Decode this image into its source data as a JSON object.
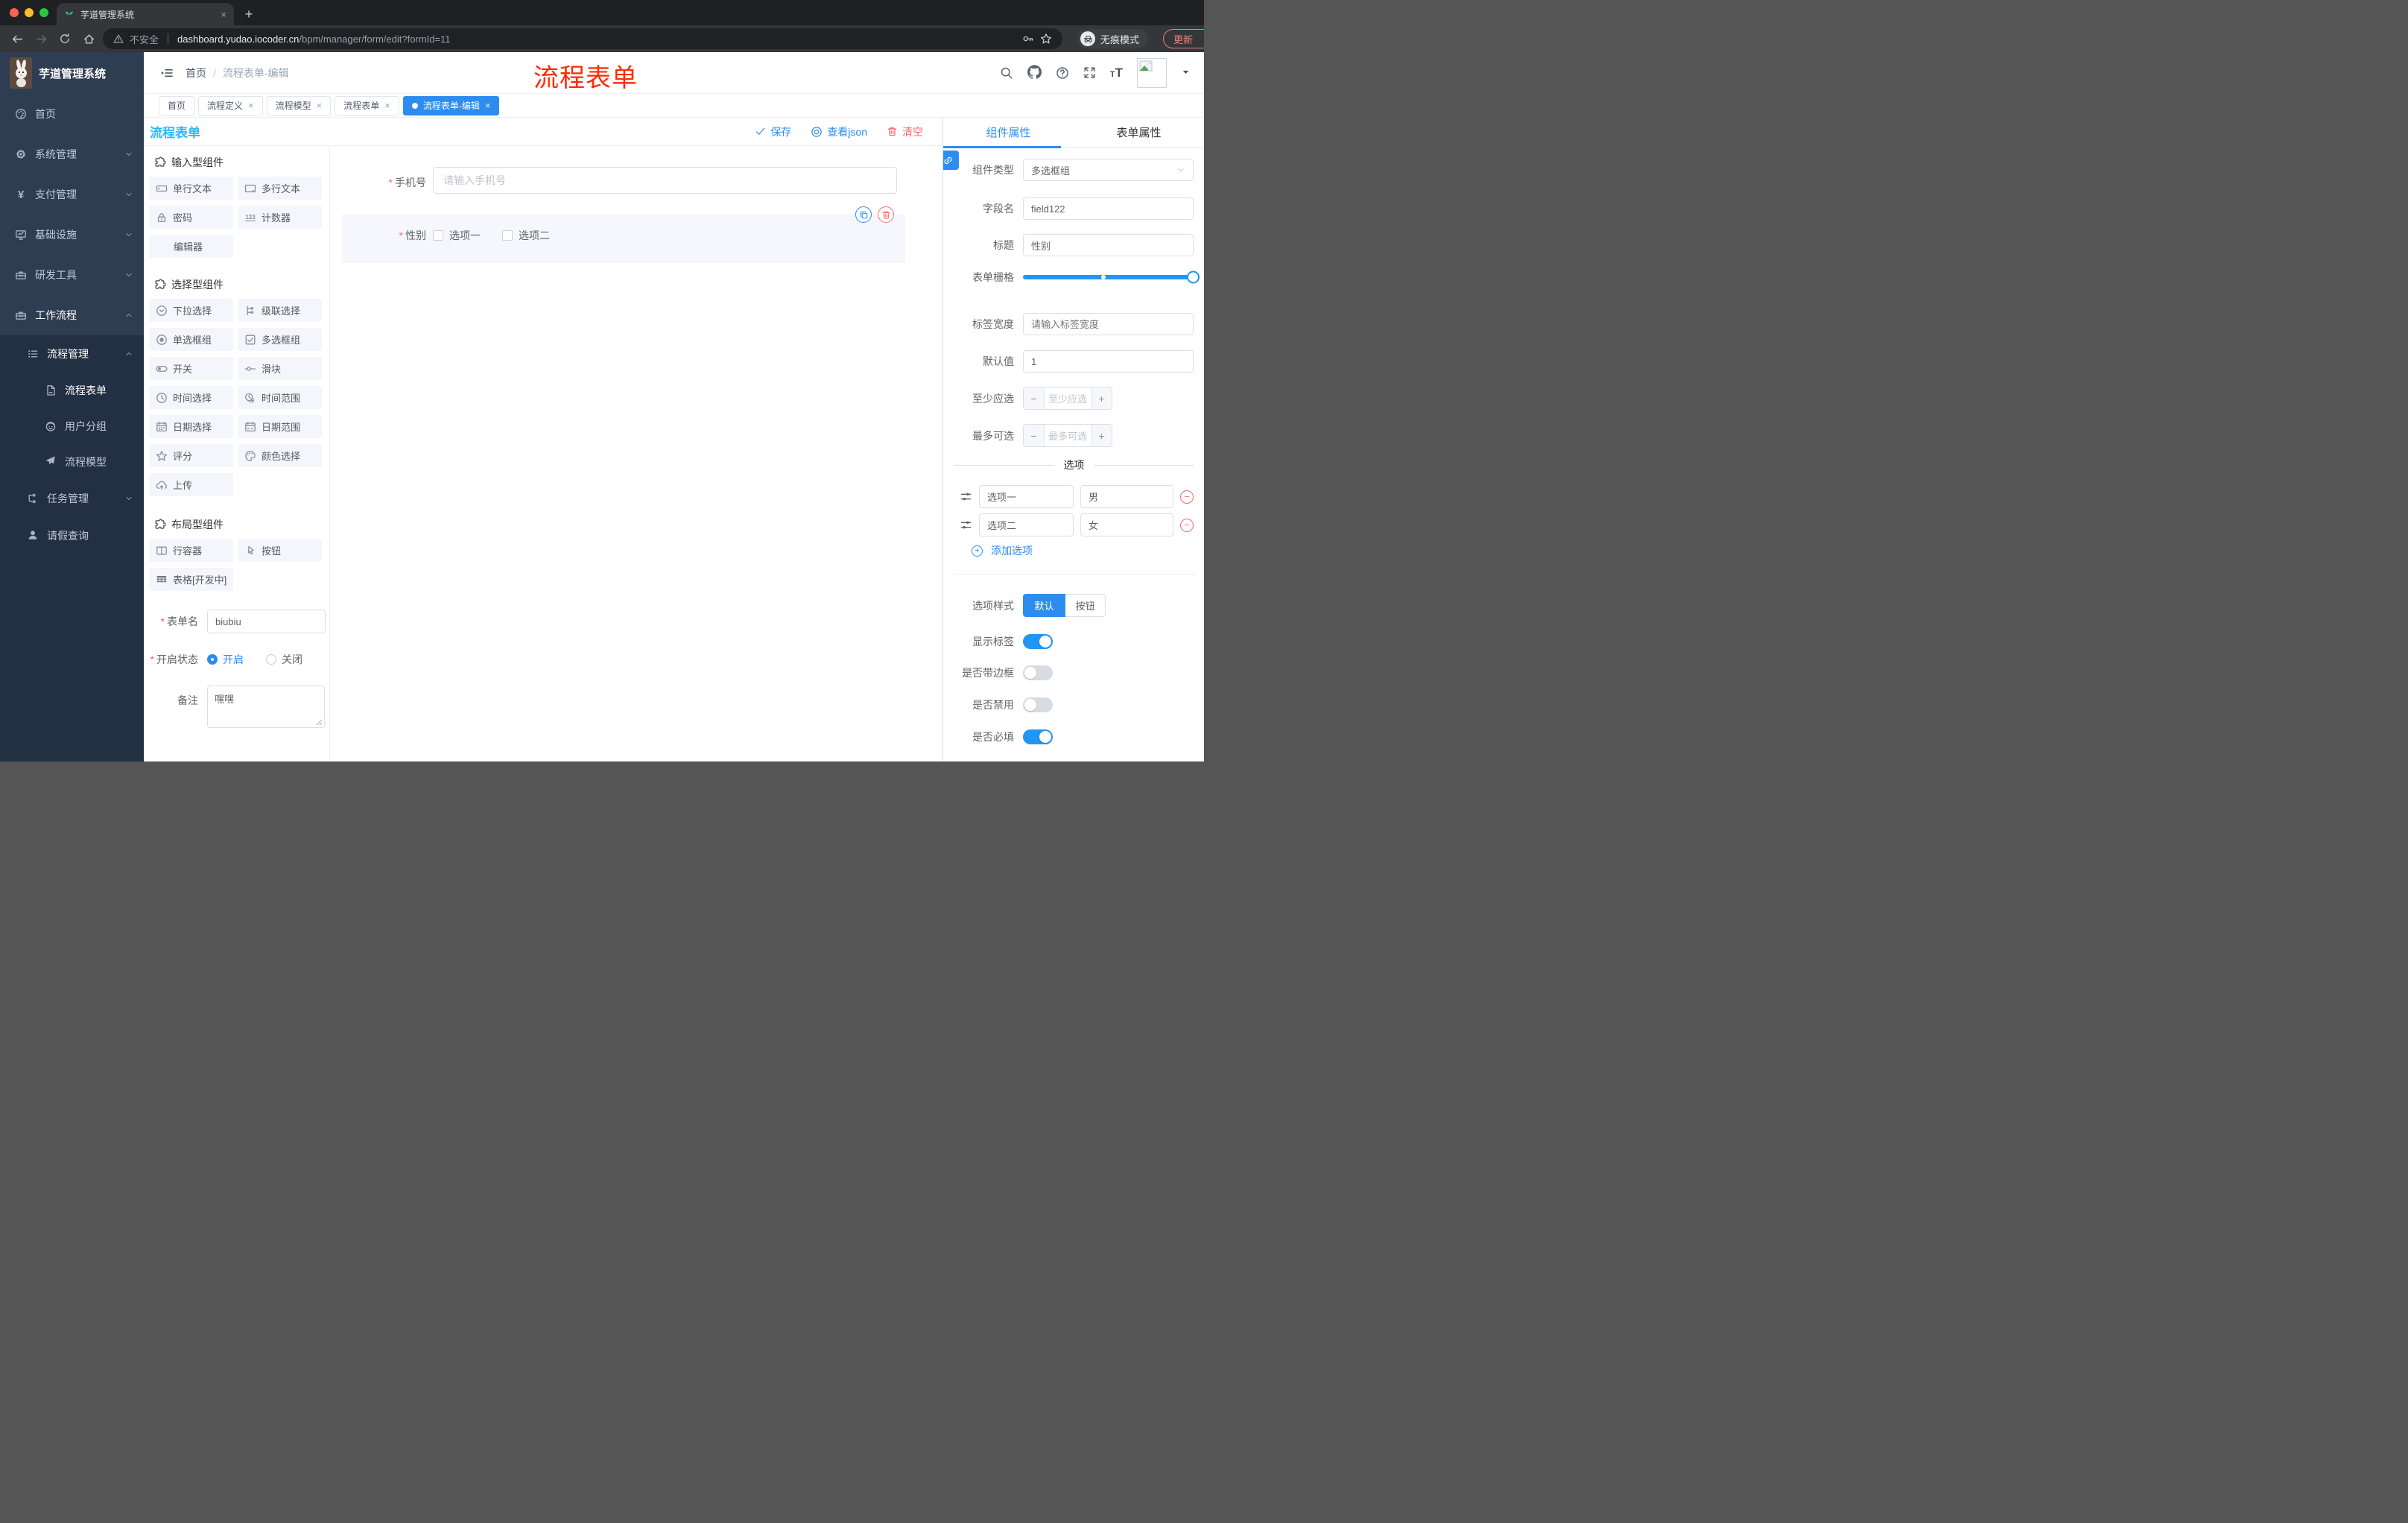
{
  "browser": {
    "tab_title": "芋道管理系统",
    "security_label": "不安全",
    "url_host": "dashboard.yudao.iocoder.cn",
    "url_path": "/bpm/manager/form/edit?formId=11",
    "incognito_label": "无痕模式",
    "update_label": "更新"
  },
  "sidebar": {
    "logo_title": "芋道管理系统",
    "items": [
      {
        "label": "首页"
      },
      {
        "label": "系统管理"
      },
      {
        "label": "支付管理"
      },
      {
        "label": "基础设施"
      },
      {
        "label": "研发工具"
      },
      {
        "label": "工作流程"
      }
    ],
    "submenu": {
      "group": "流程管理",
      "children": [
        {
          "label": "流程表单"
        },
        {
          "label": "用户分组"
        },
        {
          "label": "流程模型"
        }
      ],
      "siblings": [
        {
          "label": "任务管理"
        },
        {
          "label": "请假查询"
        }
      ]
    }
  },
  "header": {
    "breadcrumb_home": "首页",
    "breadcrumb_current": "流程表单-编辑",
    "annotation": "流程表单"
  },
  "tags": [
    {
      "label": "首页"
    },
    {
      "label": "流程定义"
    },
    {
      "label": "流程模型"
    },
    {
      "label": "流程表单"
    },
    {
      "label": "流程表单-编辑"
    }
  ],
  "canvas": {
    "title": "流程表单",
    "save_label": "保存",
    "view_json_label": "查看json",
    "clear_label": "清空",
    "phone": {
      "label": "手机号",
      "placeholder": "请输入手机号"
    },
    "gender": {
      "label": "性别",
      "option1": "选项一",
      "option2": "选项二"
    }
  },
  "palette": {
    "sections": [
      {
        "title": "输入型组件",
        "items": [
          "单行文本",
          "多行文本",
          "密码",
          "计数器",
          "编辑器"
        ]
      },
      {
        "title": "选择型组件",
        "items": [
          "下拉选择",
          "级联选择",
          "单选框组",
          "多选框组",
          "开关",
          "滑块",
          "时间选择",
          "时间范围",
          "日期选择",
          "日期范围",
          "评分",
          "颜色选择",
          "上传"
        ]
      },
      {
        "title": "布局型组件",
        "items": [
          "行容器",
          "按钮",
          "表格[开发中]"
        ]
      }
    ],
    "form": {
      "name_label": "表单名",
      "name_value": "biubiu",
      "status_label": "开启状态",
      "status_on": "开启",
      "status_off": "关闭",
      "remark_label": "备注",
      "remark_value": "嘿嘿"
    }
  },
  "panel": {
    "tab_component": "组件属性",
    "tab_form": "表单属性",
    "type_label": "组件类型",
    "type_value": "多选框组",
    "field_label": "字段名",
    "field_value": "field122",
    "title_label": "标题",
    "title_value": "性别",
    "grid_label": "表单栅格",
    "label_width_label": "标签宽度",
    "label_width_placeholder": "请输入标签宽度",
    "default_label": "默认值",
    "default_value": "1",
    "min_label": "至少应选",
    "min_placeholder": "至少应选",
    "max_label": "最多可选",
    "max_placeholder": "最多可选",
    "options_divider": "选项",
    "options": [
      {
        "label": "选项一",
        "value": "男"
      },
      {
        "label": "选项二",
        "value": "女"
      }
    ],
    "add_option": "添加选项",
    "style_label": "选项样式",
    "style_default": "默认",
    "style_button": "按钮",
    "toggles": [
      {
        "label": "显示标签",
        "on": true
      },
      {
        "label": "是否带边框",
        "on": false
      },
      {
        "label": "是否禁用",
        "on": false
      },
      {
        "label": "是否必填",
        "on": true
      }
    ]
  },
  "misc": {
    "required_marker": "*",
    "close_glyph": "×",
    "breadcrumb_separator": "/",
    "minus_glyph": "−",
    "plus_glyph": "+",
    "more_glyph": "⋮",
    "new_tab_glyph": "+",
    "counter_icon_text": "123"
  },
  "colors": {
    "accent": "#2d8cf0",
    "danger": "#f56c6c",
    "canvas_title": "#2bb8f8",
    "annotation_red": "#ff2a00",
    "switch_on": "#2196f3",
    "sidebar_bg": "#2f3d52",
    "submenu_bg": "#232f42",
    "chrome_frame": "#1f2023",
    "chrome_toolbar": "#35363a"
  }
}
